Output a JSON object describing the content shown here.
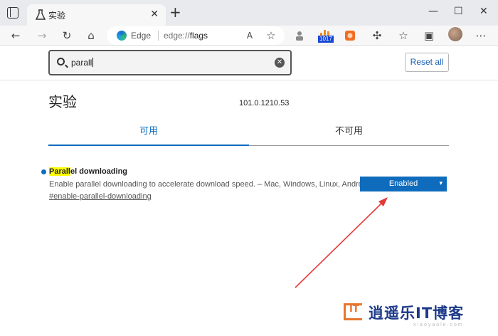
{
  "browser": {
    "tab_title": "实验",
    "tab_close": "✕",
    "new_tab": "+",
    "window": {
      "minimize": "—",
      "maximize": "☐",
      "close": "✕"
    },
    "address": {
      "prefix": "Edge",
      "scheme": "edge://",
      "host": "flags"
    },
    "extension_badge": "1017",
    "icons": {
      "back": "←",
      "forward": "→",
      "refresh": "↻",
      "home": "⌂",
      "read_aloud": "A",
      "favorite_add": "☆",
      "extension_puzzle": "✣",
      "favorites": "☆",
      "collections": "▣"
    }
  },
  "flags": {
    "search": {
      "query": "parall",
      "clear": "✕"
    },
    "reset_label": "Reset all",
    "title": "实验",
    "version": "101.0.1210.53",
    "tabs": [
      {
        "label": "可用",
        "active": true
      },
      {
        "label": "不可用",
        "active": false
      }
    ],
    "items": [
      {
        "name_highlight": "Parall",
        "name_rest": "el downloading",
        "description": "Enable parallel downloading to accelerate download speed. – Mac, Windows, Linux, Android",
        "link": "#enable-parallel-downloading",
        "value": "Enabled"
      }
    ]
  },
  "watermark": {
    "logo_text": "IT",
    "text": "逍遥乐IT博客",
    "sub": "xiaoyaole.com"
  },
  "colors": {
    "accent": "#0f6cbd",
    "highlight": "#ffff00",
    "annotation_arrow": "#e53935"
  }
}
